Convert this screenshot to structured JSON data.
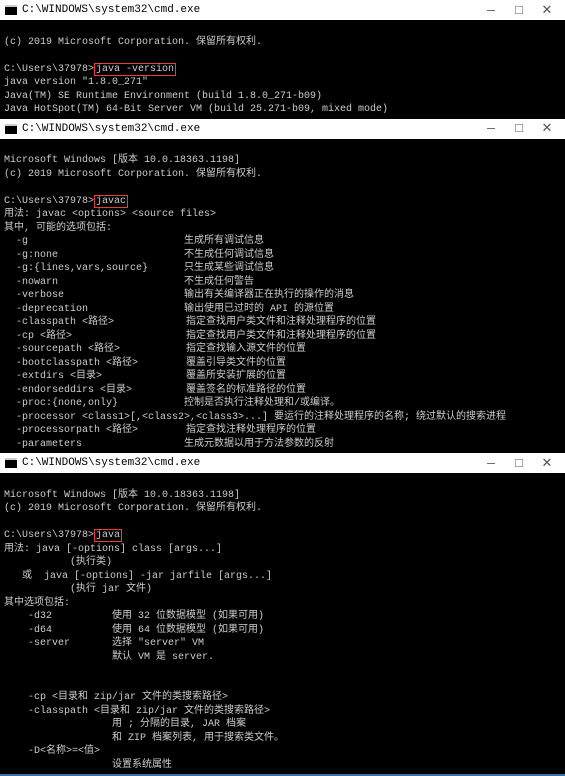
{
  "titlebar_path": "C:\\WINDOWS\\system32\\cmd.exe",
  "window_icons": {
    "min": "—",
    "max": "□",
    "close": "✕"
  },
  "w1": {
    "copyright": "(c) 2019 Microsoft Corporation. 保留所有权利.",
    "prompt": "C:\\Users\\37978>",
    "cmd": "java -version",
    "l1": "java version \"1.8.0_271\"",
    "l2": "Java(TM) SE Runtime Environment (build 1.8.0_271-b09)",
    "l3": "Java HotSpot(TM) 64-Bit Server VM (build 25.271-b09, mixed mode)"
  },
  "w2": {
    "ver": "Microsoft Windows [版本 10.0.18363.1198]",
    "copyright": "(c) 2019 Microsoft Corporation. 保留所有权利.",
    "prompt": "C:\\Users\\37978>",
    "cmd": "javac",
    "usage": "用法: javac <options> <source files>",
    "header2": "其中, 可能的选项包括:",
    "opts": [
      {
        "f": "  -g",
        "d": "                          生成所有调试信息"
      },
      {
        "f": "  -g:none",
        "d": "                     不生成任何调试信息"
      },
      {
        "f": "  -g:{lines,vars,source}",
        "d": "      只生成某些调试信息"
      },
      {
        "f": "  -nowarn",
        "d": "                     不生成任何警告"
      },
      {
        "f": "  -verbose",
        "d": "                    输出有关编译器正在执行的操作的消息"
      },
      {
        "f": "  -deprecation",
        "d": "                输出使用已过时的 API 的源位置"
      },
      {
        "f": "  -classpath <路径>",
        "d": "            指定查找用户类文件和注释处理程序的位置"
      },
      {
        "f": "  -cp <路径>",
        "d": "                   指定查找用户类文件和注释处理程序的位置"
      },
      {
        "f": "  -sourcepath <路径>",
        "d": "           指定查找输入源文件的位置"
      },
      {
        "f": "  -bootclasspath <路径>",
        "d": "        覆盖引导类文件的位置"
      },
      {
        "f": "  -extdirs <目录>",
        "d": "              覆盖所安装扩展的位置"
      },
      {
        "f": "  -endorseddirs <目录>",
        "d": "         覆盖签名的标准路径的位置"
      },
      {
        "f": "  -proc:{none,only}",
        "d": "           控制是否执行注释处理和/或编译。"
      },
      {
        "f": "  -processor <class1>[,<class2>,<class3>...] 要运行的注释处理程序的名称; 绕过默认的搜索进程",
        "d": ""
      },
      {
        "f": "  -processorpath <路径>",
        "d": "        指定查找注释处理程序的位置"
      },
      {
        "f": "  -parameters",
        "d": "                 生成元数据以用于方法参数的反射"
      }
    ]
  },
  "w3": {
    "ver": "Microsoft Windows [版本 10.0.18363.1198]",
    "copyright": "(c) 2019 Microsoft Corporation. 保留所有权利.",
    "prompt": "C:\\Users\\37978>",
    "cmd": "java",
    "l1": "用法: java [-options] class [args...]",
    "l2": "           (执行类)",
    "l3": "   或  java [-options] -jar jarfile [args...]",
    "l4": "           (执行 jar 文件)",
    "l5": "其中选项包括:",
    "opts": [
      {
        "f": "    -d32",
        "d": "          使用 32 位数据模型 (如果可用)"
      },
      {
        "f": "    -d64",
        "d": "          使用 64 位数据模型 (如果可用)"
      },
      {
        "f": "    -server",
        "d": "       选择 \"server\" VM"
      },
      {
        "f": "",
        "d": "                  默认 VM 是 server."
      }
    ],
    "cp1": "    -cp <目录和 zip/jar 文件的类搜索路径>",
    "cp2": "    -classpath <目录和 zip/jar 文件的类搜索路径>",
    "cp3": "                  用 ; 分隔的目录, JAR 档案",
    "cp4": "                  和 ZIP 档案列表, 用于搜索类文件。",
    "d1": "    -D<名称>=<值>",
    "d2": "                  设置系统属性"
  }
}
